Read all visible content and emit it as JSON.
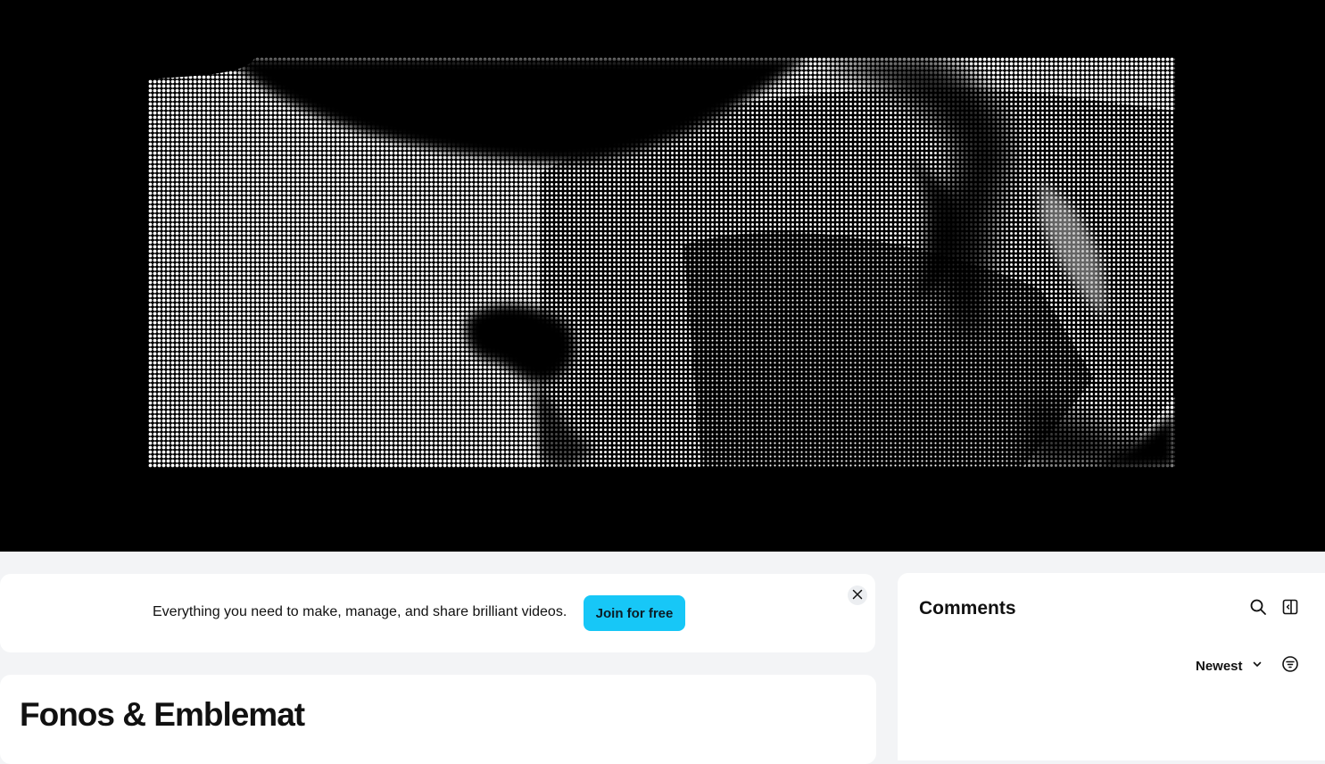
{
  "player": {
    "background_color": "#000000",
    "frame_description_icon": "halftone-video-frame"
  },
  "banner": {
    "message": "Everything you need to make, manage, and share brilliant videos.",
    "cta_label": "Join for free",
    "cta_color": "#17c7f7",
    "close_icon": "close-icon"
  },
  "video": {
    "title": "Fonos & Emblemat"
  },
  "comments": {
    "title": "Comments",
    "search_icon": "search-icon",
    "panel_icon": "sidebar-toggle-icon",
    "sort_selected": "Newest",
    "sort_icon": "chevron-down-icon",
    "filter_icon": "filter-icon"
  }
}
